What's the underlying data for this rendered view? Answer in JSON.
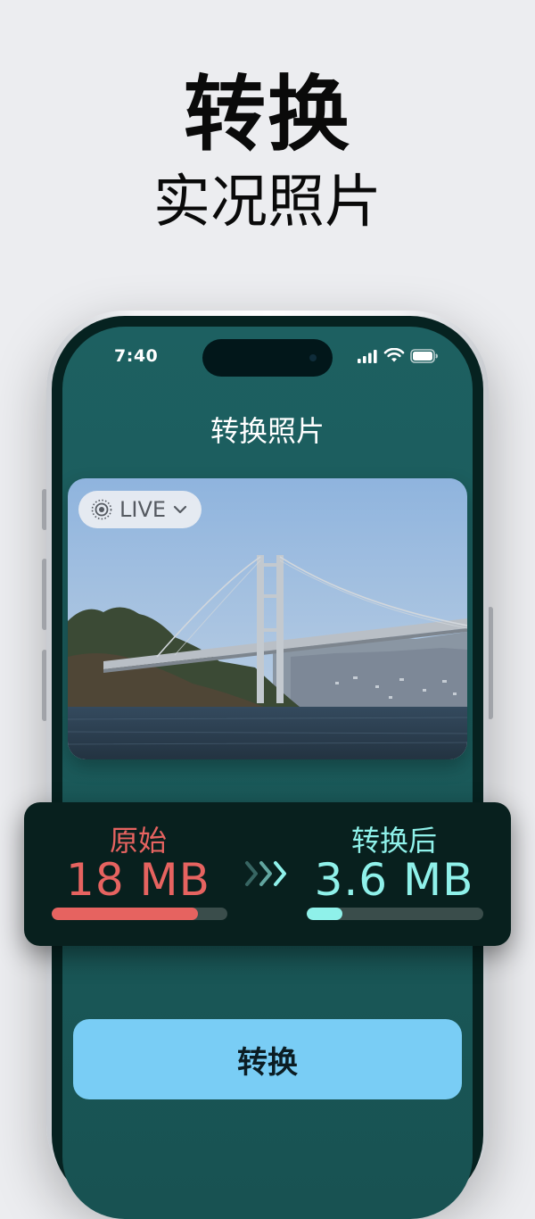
{
  "promo": {
    "headline": "转换",
    "subheadline": "实况照片"
  },
  "status_bar": {
    "time": "7:40",
    "icons": [
      "signal-icon",
      "wifi-icon",
      "battery-icon"
    ]
  },
  "screen": {
    "title": "转换照片"
  },
  "photo": {
    "subject": "Bay Bridge over water",
    "live_badge": {
      "label": "LIVE",
      "icons": [
        "live-photo-icon",
        "chevron-down-icon"
      ]
    }
  },
  "comparison": {
    "original": {
      "label": "原始",
      "value": "18 MB",
      "fraction": 0.83,
      "color": "#e66360"
    },
    "converted": {
      "label": "转换后",
      "value": "3.6 MB",
      "fraction": 0.2,
      "color": "#8ff1ea"
    },
    "arrow_icon": "triple-chevron-right-icon"
  },
  "actions": {
    "convert_label": "转换"
  },
  "colors": {
    "background": "#ecedf0",
    "screen": "#1d6061",
    "panel": "#08201e",
    "button": "#79cdf5"
  }
}
